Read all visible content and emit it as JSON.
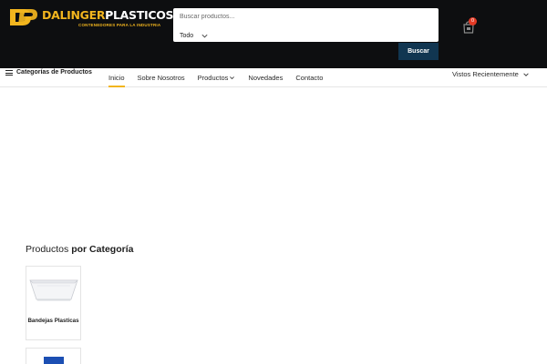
{
  "header": {
    "logo": {
      "brand_left": "DALINGER",
      "brand_right": "PLASTICOS",
      "tagline": "CONTENEDORES PARA LA INDUSTRIA"
    },
    "search": {
      "placeholder": "Buscar productos...",
      "category_selected": "Todo",
      "button_label": "Buscar"
    },
    "cart": {
      "count": "0",
      "icon": "shopping-bag-icon"
    },
    "colors": {
      "background": "#0d0e10",
      "brand_yellow": "#f2b51e",
      "button_blue": "#113651",
      "badge_red": "#e43a25"
    }
  },
  "navbar": {
    "categories_toggle": "Categorías de Productos",
    "links": [
      {
        "label": "Inicio",
        "active": true
      },
      {
        "label": "Sobre Nosotros"
      },
      {
        "label": "Productos",
        "dropdown": true
      },
      {
        "label": "Novedades"
      },
      {
        "label": "Contacto"
      }
    ],
    "recent_label": "Vistos Recientemente"
  },
  "content": {
    "section_title_prefix": "Productos",
    "section_title_strong": "por Categoría",
    "categories": [
      {
        "label": "Bandejas Plasticas",
        "icon": "white-tray-image"
      },
      {
        "label": "",
        "icon": "blue-container-image"
      }
    ]
  }
}
